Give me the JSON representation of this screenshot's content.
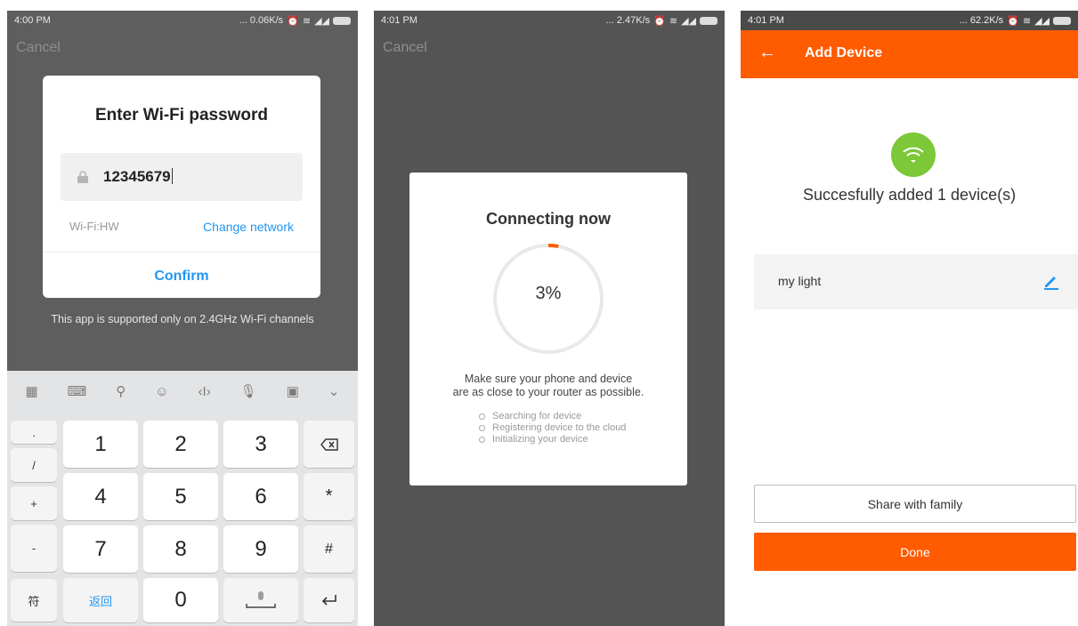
{
  "panel1": {
    "status": {
      "time": "4:00 PM",
      "speed": "... 0.06K/s"
    },
    "cancel": "Cancel",
    "dialog": {
      "title": "Enter Wi-Fi password",
      "password": "12345679",
      "wifi_label": "Wi-Fi:HW",
      "change_network": "Change network",
      "confirm": "Confirm"
    },
    "support_note": "This app is supported only on 2.4GHz Wi-Fi channels",
    "keyboard": {
      "side_left": [
        ".",
        "/",
        "+",
        "-",
        "符"
      ],
      "digits": [
        "1",
        "2",
        "3",
        "4",
        "5",
        "6",
        "7",
        "8",
        "9",
        "0"
      ],
      "back_key": "返回",
      "right_keys": [
        "*",
        "#"
      ]
    }
  },
  "panel2": {
    "status": {
      "time": "4:01 PM",
      "speed": "... 2.47K/s"
    },
    "cancel": "Cancel",
    "card": {
      "title": "Connecting now",
      "progress_percent": 3,
      "progress_label": "3%",
      "hint_line1": "Make sure your phone and device",
      "hint_line2": "are as close to your router as possible.",
      "steps": [
        "Searching for device",
        "Registering device to the cloud",
        "Initializing your device"
      ]
    },
    "accent": "#ff5b00"
  },
  "panel3": {
    "status": {
      "time": "4:01 PM",
      "speed": "... 62.2K/s"
    },
    "appbar_title": "Add Device",
    "success": "Succesfully added 1 device(s)",
    "device_name": "my light",
    "share": "Share with family",
    "done": "Done",
    "accent": "#ff5b00",
    "success_color": "#7cc838"
  }
}
